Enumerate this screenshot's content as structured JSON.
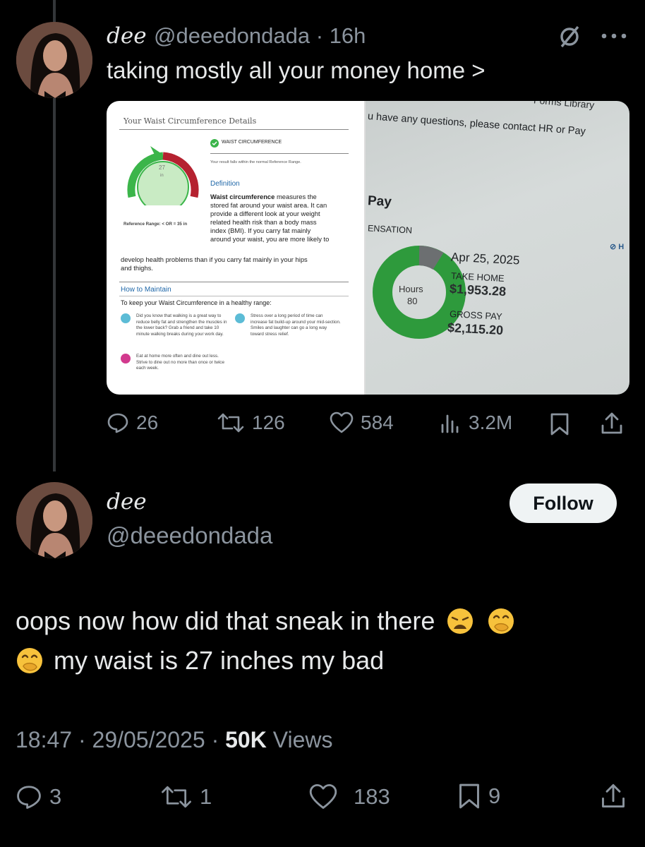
{
  "tweet1": {
    "name": "dee",
    "handle": "@deeedondada",
    "time": "16h",
    "text": "taking mostly all your money home >",
    "more_icon": "more-icon",
    "grok_icon": "slashed-circle-icon",
    "stats": {
      "replies": "26",
      "reposts": "126",
      "likes": "584",
      "views": "3.2M"
    }
  },
  "waist_doc": {
    "title": "Your Waist Circumference Details",
    "gauge_value": "27",
    "gauge_unit": "in",
    "section_heading": "WAIST CIRCUMFERENCE",
    "result_text": "Your result falls within the normal Reference Range.",
    "reference_range": "Reference Range: < OR = 35 in",
    "definition_heading": "Definition",
    "definition_bold": "Waist circumference",
    "definition_line1": "measures the",
    "definition_lines": [
      "stored fat around your waist area. It can",
      "provide a different look at your weight",
      "related health risk than a body mass",
      "index (BMI). If you carry fat mainly",
      "around your waist, you are more likely to"
    ],
    "definition_wide_lines": [
      "develop health problems than if you carry fat mainly in your hips",
      "and thighs."
    ],
    "maintain_heading": "How to Maintain",
    "maintain_intro": "To keep your Waist Circumference in a healthy range:",
    "tip1": "Did you know that walking is a great way to reduce belly fat and strengthen the muscles in the lower back? Grab a friend and take 10 minute walking breaks during your work day.",
    "tip2": "Stress over a long period of time can increase fat build-up around your mid-section. Smiles and laughter can go a long way toward stress relief.",
    "tip3": "Eat at home more often and dine out less. Strive to dine out no more than once or twice each week."
  },
  "pay_photo": {
    "top_fragment": "Forms Library",
    "contact_text": "u have any questions, please contact HR or Pay",
    "pay_label": "Pay",
    "compensation_label": "ENSATION",
    "hide_label": "H",
    "hours_label": "Hours",
    "hours_value": "80",
    "date": "Apr 25, 2025",
    "take_home_label": "TAKE HOME",
    "take_home": "$1,953.28",
    "gross_label": "GROSS PAY",
    "gross": "$2,115.20"
  },
  "tweet2": {
    "name": "dee",
    "handle": "@deeedondada",
    "follow_label": "Follow",
    "text_line1": "oops now how did that sneak in there",
    "text_line2": "my waist is 27 inches my bad",
    "emojis": [
      "weary-face-emoji",
      "hand-over-mouth-emoji",
      "hand-over-mouth-emoji"
    ],
    "timestamp": "18:47 · 29/05/2025 ·",
    "views_count": "50K",
    "views_label": "Views",
    "stats": {
      "replies": "3",
      "reposts": "1",
      "likes": "183",
      "bookmarks": "9"
    }
  },
  "colors": {
    "background": "#000000",
    "text": "#e7e9ea",
    "muted": "#8b949e",
    "gauge_green": "#3bb54a",
    "gauge_red": "#b52230",
    "donut_green": "#2e9a3c"
  }
}
